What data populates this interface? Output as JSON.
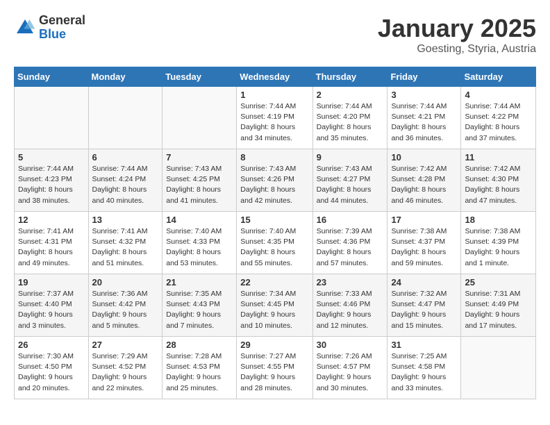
{
  "header": {
    "logo_general": "General",
    "logo_blue": "Blue",
    "title": "January 2025",
    "location": "Goesting, Styria, Austria"
  },
  "weekdays": [
    "Sunday",
    "Monday",
    "Tuesday",
    "Wednesday",
    "Thursday",
    "Friday",
    "Saturday"
  ],
  "weeks": [
    [
      {
        "day": "",
        "info": ""
      },
      {
        "day": "",
        "info": ""
      },
      {
        "day": "",
        "info": ""
      },
      {
        "day": "1",
        "info": "Sunrise: 7:44 AM\nSunset: 4:19 PM\nDaylight: 8 hours\nand 34 minutes."
      },
      {
        "day": "2",
        "info": "Sunrise: 7:44 AM\nSunset: 4:20 PM\nDaylight: 8 hours\nand 35 minutes."
      },
      {
        "day": "3",
        "info": "Sunrise: 7:44 AM\nSunset: 4:21 PM\nDaylight: 8 hours\nand 36 minutes."
      },
      {
        "day": "4",
        "info": "Sunrise: 7:44 AM\nSunset: 4:22 PM\nDaylight: 8 hours\nand 37 minutes."
      }
    ],
    [
      {
        "day": "5",
        "info": "Sunrise: 7:44 AM\nSunset: 4:23 PM\nDaylight: 8 hours\nand 38 minutes."
      },
      {
        "day": "6",
        "info": "Sunrise: 7:44 AM\nSunset: 4:24 PM\nDaylight: 8 hours\nand 40 minutes."
      },
      {
        "day": "7",
        "info": "Sunrise: 7:43 AM\nSunset: 4:25 PM\nDaylight: 8 hours\nand 41 minutes."
      },
      {
        "day": "8",
        "info": "Sunrise: 7:43 AM\nSunset: 4:26 PM\nDaylight: 8 hours\nand 42 minutes."
      },
      {
        "day": "9",
        "info": "Sunrise: 7:43 AM\nSunset: 4:27 PM\nDaylight: 8 hours\nand 44 minutes."
      },
      {
        "day": "10",
        "info": "Sunrise: 7:42 AM\nSunset: 4:28 PM\nDaylight: 8 hours\nand 46 minutes."
      },
      {
        "day": "11",
        "info": "Sunrise: 7:42 AM\nSunset: 4:30 PM\nDaylight: 8 hours\nand 47 minutes."
      }
    ],
    [
      {
        "day": "12",
        "info": "Sunrise: 7:41 AM\nSunset: 4:31 PM\nDaylight: 8 hours\nand 49 minutes."
      },
      {
        "day": "13",
        "info": "Sunrise: 7:41 AM\nSunset: 4:32 PM\nDaylight: 8 hours\nand 51 minutes."
      },
      {
        "day": "14",
        "info": "Sunrise: 7:40 AM\nSunset: 4:33 PM\nDaylight: 8 hours\nand 53 minutes."
      },
      {
        "day": "15",
        "info": "Sunrise: 7:40 AM\nSunset: 4:35 PM\nDaylight: 8 hours\nand 55 minutes."
      },
      {
        "day": "16",
        "info": "Sunrise: 7:39 AM\nSunset: 4:36 PM\nDaylight: 8 hours\nand 57 minutes."
      },
      {
        "day": "17",
        "info": "Sunrise: 7:38 AM\nSunset: 4:37 PM\nDaylight: 8 hours\nand 59 minutes."
      },
      {
        "day": "18",
        "info": "Sunrise: 7:38 AM\nSunset: 4:39 PM\nDaylight: 9 hours\nand 1 minute."
      }
    ],
    [
      {
        "day": "19",
        "info": "Sunrise: 7:37 AM\nSunset: 4:40 PM\nDaylight: 9 hours\nand 3 minutes."
      },
      {
        "day": "20",
        "info": "Sunrise: 7:36 AM\nSunset: 4:42 PM\nDaylight: 9 hours\nand 5 minutes."
      },
      {
        "day": "21",
        "info": "Sunrise: 7:35 AM\nSunset: 4:43 PM\nDaylight: 9 hours\nand 7 minutes."
      },
      {
        "day": "22",
        "info": "Sunrise: 7:34 AM\nSunset: 4:45 PM\nDaylight: 9 hours\nand 10 minutes."
      },
      {
        "day": "23",
        "info": "Sunrise: 7:33 AM\nSunset: 4:46 PM\nDaylight: 9 hours\nand 12 minutes."
      },
      {
        "day": "24",
        "info": "Sunrise: 7:32 AM\nSunset: 4:47 PM\nDaylight: 9 hours\nand 15 minutes."
      },
      {
        "day": "25",
        "info": "Sunrise: 7:31 AM\nSunset: 4:49 PM\nDaylight: 9 hours\nand 17 minutes."
      }
    ],
    [
      {
        "day": "26",
        "info": "Sunrise: 7:30 AM\nSunset: 4:50 PM\nDaylight: 9 hours\nand 20 minutes."
      },
      {
        "day": "27",
        "info": "Sunrise: 7:29 AM\nSunset: 4:52 PM\nDaylight: 9 hours\nand 22 minutes."
      },
      {
        "day": "28",
        "info": "Sunrise: 7:28 AM\nSunset: 4:53 PM\nDaylight: 9 hours\nand 25 minutes."
      },
      {
        "day": "29",
        "info": "Sunrise: 7:27 AM\nSunset: 4:55 PM\nDaylight: 9 hours\nand 28 minutes."
      },
      {
        "day": "30",
        "info": "Sunrise: 7:26 AM\nSunset: 4:57 PM\nDaylight: 9 hours\nand 30 minutes."
      },
      {
        "day": "31",
        "info": "Sunrise: 7:25 AM\nSunset: 4:58 PM\nDaylight: 9 hours\nand 33 minutes."
      },
      {
        "day": "",
        "info": ""
      }
    ]
  ]
}
